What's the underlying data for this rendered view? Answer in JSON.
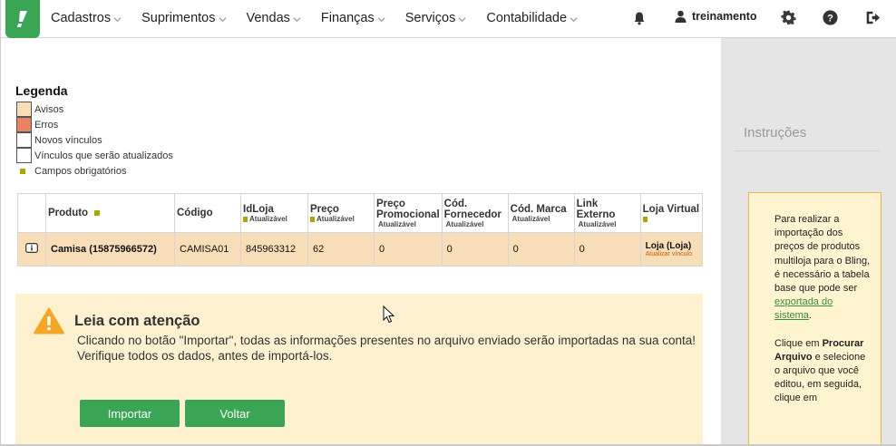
{
  "nav": {
    "items": [
      {
        "label": "Cadastros"
      },
      {
        "label": "Suprimentos"
      },
      {
        "label": "Vendas"
      },
      {
        "label": "Finanças"
      },
      {
        "label": "Serviços"
      },
      {
        "label": "Contabilidade"
      }
    ],
    "user": "treinamento",
    "icons": [
      "bell-icon",
      "user-icon",
      "gear-icon",
      "help-icon",
      "logout-icon"
    ]
  },
  "legend": {
    "title": "Legenda",
    "items": [
      {
        "label": "Avisos",
        "color": "#f8deb8"
      },
      {
        "label": "Erros",
        "color": "#e9825e"
      },
      {
        "label": "Novos vínculos",
        "color": "#ffffff"
      },
      {
        "label": "Vínculos que serão atualizados",
        "color": "#ffffff"
      }
    ],
    "required_label": "Campos obrigatórios",
    "required_color": "#a8a800"
  },
  "table": {
    "headers": [
      {
        "label": "Produto",
        "sub": ""
      },
      {
        "label": "Código",
        "sub": ""
      },
      {
        "label": "IdLoja",
        "sub": "Atualizável"
      },
      {
        "label": "Preço",
        "sub": "Atualizável"
      },
      {
        "label": "Preço Promocional",
        "sub": "Atualizável"
      },
      {
        "label": "Cód. Fornecedor",
        "sub": "Atualizável"
      },
      {
        "label": "Cód. Marca",
        "sub": "Atualizável"
      },
      {
        "label": "Link Externo",
        "sub": "Atualizável"
      },
      {
        "label": "Loja Virtual",
        "sub": ""
      }
    ],
    "rows": [
      {
        "produto": "Camisa (15875966572)",
        "codigo": "CAMISA01",
        "idloja": "845963312",
        "preco": "62",
        "preco_promocional": "0",
        "cod_fornecedor": "0",
        "cod_marca": "0",
        "link_externo": "0",
        "loja_virtual": "Loja (Loja)",
        "loja_link": "Atualizar vínculo"
      }
    ]
  },
  "warning": {
    "title": "Leia com atenção",
    "text1": "Clicando no botão \"Importar\", todas as informações presentes no arquivo enviado serão importadas na sua conta!",
    "text2": "Verifique todos os dados, antes de importá-los.",
    "import_label": "Importar",
    "back_label": "Voltar"
  },
  "instructions": {
    "title": "Instruções",
    "p1_before": "Para realizar a importação dos preços de produtos multiloja para o Bling, é necessário a tabela base que pode ser",
    "p1_link": "exportada do sistema",
    "p1_after": ".",
    "p2_before": "Clique em",
    "p2_bold": "Procurar Arquivo",
    "p2_after": "e selecione o arquivo que você editou, em seguida, clique em"
  },
  "colors": {
    "brand_green": "#3aa655",
    "warning_bg": "#fdf1d0",
    "row_bg": "#f8deb8",
    "panel_bg": "#e5e5e5"
  }
}
